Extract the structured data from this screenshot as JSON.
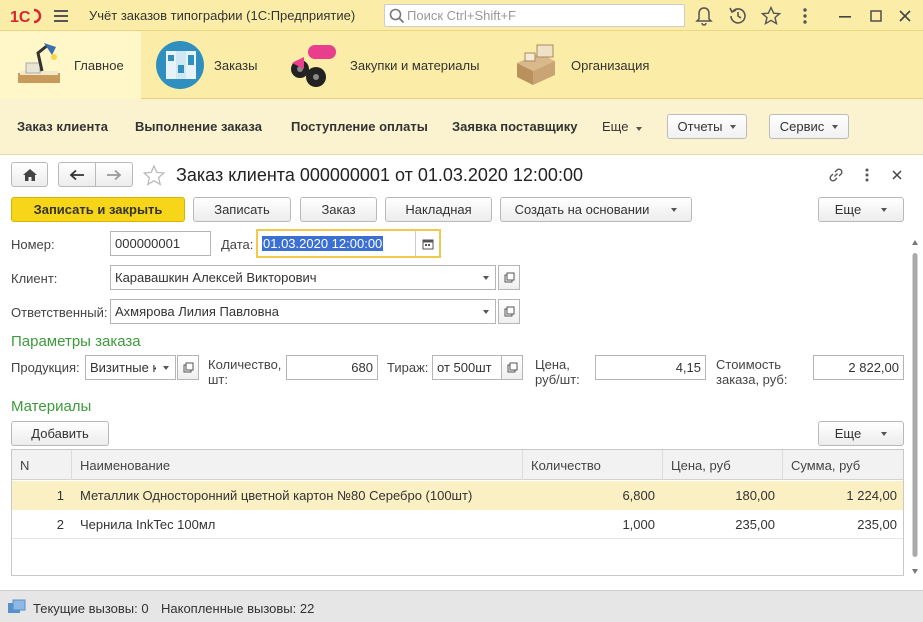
{
  "app": {
    "title": "Учёт заказов типографии (1С:Предприятие)",
    "search_placeholder": "Поиск Ctrl+Shift+F",
    "accent_color": "#f7d619",
    "titlebar_color": "#fbeda7"
  },
  "sections": [
    {
      "label": "Главное",
      "icon": "desk-lamp-icon"
    },
    {
      "label": "Заказы",
      "icon": "brochure-icon"
    },
    {
      "label": "Закупки и материалы",
      "icon": "paint-rollers-icon"
    },
    {
      "label": "Организация",
      "icon": "boxes-icon"
    }
  ],
  "commands": {
    "items": [
      "Заказ клиента",
      "Выполнение заказа",
      "Поступление оплаты",
      "Заявка поставщику"
    ],
    "more": "Еще",
    "reports": "Отчеты",
    "service": "Сервис"
  },
  "form": {
    "title": "Заказ клиента 000000001 от 01.03.2020 12:00:00",
    "toolbar": {
      "save_close": "Записать и закрыть",
      "save": "Записать",
      "order": "Заказ",
      "invoice": "Накладная",
      "create_based": "Создать на основании",
      "more": "Еще"
    },
    "fields": {
      "number_label": "Номер:",
      "number_value": "000000001",
      "date_label": "Дата:",
      "date_value": "01.03.2020 12:00:00",
      "client_label": "Клиент:",
      "client_value": "Каравашкин Алексей Викторович",
      "responsible_label": "Ответственный:",
      "responsible_value": "Ахмярова Лилия Павловна"
    },
    "params": {
      "group_title": "Параметры заказа",
      "product_label": "Продукция:",
      "product_value": "Визитные к",
      "quantity_label_1": "Количество,",
      "quantity_label_2": "шт:",
      "quantity_value": "680",
      "edition_label": "Тираж:",
      "edition_value": "от 500шт",
      "price_label_1": "Цена,",
      "price_label_2": "руб/шт:",
      "price_value": "4,15",
      "cost_label_1": "Стоимость",
      "cost_label_2": "заказа, руб:",
      "cost_value": "2 822,00"
    },
    "materials": {
      "group_title": "Материалы",
      "add_button": "Добавить",
      "more_button": "Еще",
      "columns": [
        "N",
        "Наименование",
        "Количество",
        "Цена, руб",
        "Сумма, руб"
      ],
      "rows": [
        {
          "n": "1",
          "name": "Металлик Односторонний цветной картон №80 Серебро (100шт)",
          "qty": "6,800",
          "price": "180,00",
          "sum": "1 224,00"
        },
        {
          "n": "2",
          "name": "Чернила InkTec 100мл",
          "qty": "1,000",
          "price": "235,00",
          "sum": "235,00"
        }
      ]
    }
  },
  "status": {
    "current": "Текущие вызовы: 0",
    "accumulated": "Накопленные вызовы: 22"
  }
}
